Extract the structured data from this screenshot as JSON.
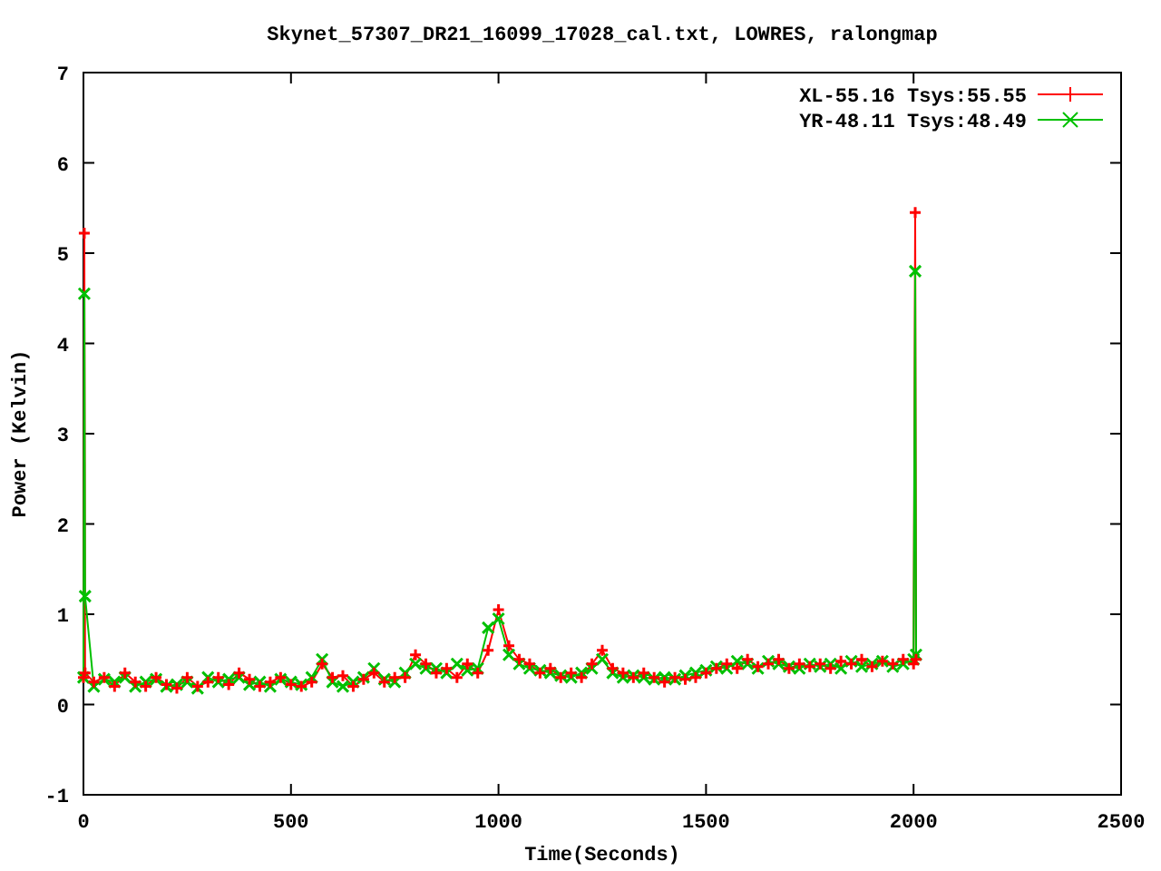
{
  "chart_data": {
    "type": "line",
    "title": "Skynet_57307_DR21_16099_17028_cal.txt, LOWRES, ralongmap",
    "xlabel": "Time(Seconds)",
    "ylabel": "Power (Kelvin)",
    "x": [
      0,
      2,
      4,
      25,
      50,
      75,
      100,
      125,
      150,
      175,
      200,
      225,
      250,
      275,
      300,
      325,
      350,
      375,
      400,
      425,
      450,
      475,
      500,
      525,
      550,
      575,
      600,
      625,
      650,
      675,
      700,
      725,
      750,
      775,
      800,
      825,
      850,
      875,
      900,
      925,
      950,
      975,
      1000,
      1025,
      1050,
      1075,
      1100,
      1125,
      1150,
      1175,
      1200,
      1225,
      1250,
      1275,
      1300,
      1325,
      1350,
      1375,
      1400,
      1425,
      1450,
      1475,
      1500,
      1525,
      1550,
      1575,
      1600,
      1625,
      1650,
      1675,
      1700,
      1725,
      1750,
      1775,
      1800,
      1825,
      1850,
      1875,
      1900,
      1925,
      1950,
      1975,
      2000,
      2004,
      2006
    ],
    "series": [
      {
        "name": "XL-55.16 Tsys:55.55",
        "color": "#ff0000",
        "marker": "+",
        "values": [
          0.3,
          5.22,
          0.35,
          0.25,
          0.3,
          0.2,
          0.35,
          0.25,
          0.2,
          0.3,
          0.22,
          0.18,
          0.3,
          0.2,
          0.25,
          0.3,
          0.22,
          0.35,
          0.28,
          0.2,
          0.25,
          0.3,
          0.22,
          0.2,
          0.25,
          0.45,
          0.3,
          0.32,
          0.2,
          0.28,
          0.35,
          0.25,
          0.3,
          0.3,
          0.55,
          0.45,
          0.35,
          0.4,
          0.3,
          0.45,
          0.35,
          0.6,
          1.05,
          0.65,
          0.5,
          0.45,
          0.35,
          0.4,
          0.3,
          0.35,
          0.3,
          0.45,
          0.6,
          0.4,
          0.35,
          0.3,
          0.35,
          0.3,
          0.25,
          0.3,
          0.28,
          0.3,
          0.35,
          0.4,
          0.45,
          0.4,
          0.5,
          0.42,
          0.45,
          0.5,
          0.4,
          0.45,
          0.42,
          0.45,
          0.4,
          0.48,
          0.45,
          0.5,
          0.42,
          0.48,
          0.45,
          0.5,
          0.45,
          5.45,
          0.5
        ]
      },
      {
        "name": "YR-48.11 Tsys:48.49",
        "color": "#00c000",
        "marker": "x",
        "values": [
          0.3,
          4.55,
          1.2,
          0.2,
          0.28,
          0.25,
          0.3,
          0.2,
          0.25,
          0.28,
          0.2,
          0.22,
          0.25,
          0.18,
          0.3,
          0.25,
          0.28,
          0.3,
          0.22,
          0.25,
          0.2,
          0.28,
          0.25,
          0.22,
          0.3,
          0.5,
          0.25,
          0.2,
          0.25,
          0.3,
          0.4,
          0.28,
          0.25,
          0.35,
          0.45,
          0.4,
          0.4,
          0.35,
          0.45,
          0.38,
          0.4,
          0.85,
          0.95,
          0.55,
          0.45,
          0.4,
          0.38,
          0.35,
          0.32,
          0.3,
          0.35,
          0.4,
          0.5,
          0.35,
          0.3,
          0.32,
          0.3,
          0.28,
          0.3,
          0.28,
          0.32,
          0.35,
          0.38,
          0.42,
          0.4,
          0.48,
          0.45,
          0.4,
          0.48,
          0.45,
          0.42,
          0.4,
          0.45,
          0.42,
          0.45,
          0.4,
          0.48,
          0.42,
          0.45,
          0.48,
          0.42,
          0.45,
          0.5,
          4.8,
          0.55
        ]
      }
    ],
    "legend": true,
    "xlim": [
      0,
      2500
    ],
    "ylim": [
      -1,
      7
    ],
    "xticks": [
      0,
      500,
      1000,
      1500,
      2000,
      2500
    ],
    "yticks": [
      -1,
      0,
      1,
      2,
      3,
      4,
      5,
      6,
      7
    ]
  }
}
